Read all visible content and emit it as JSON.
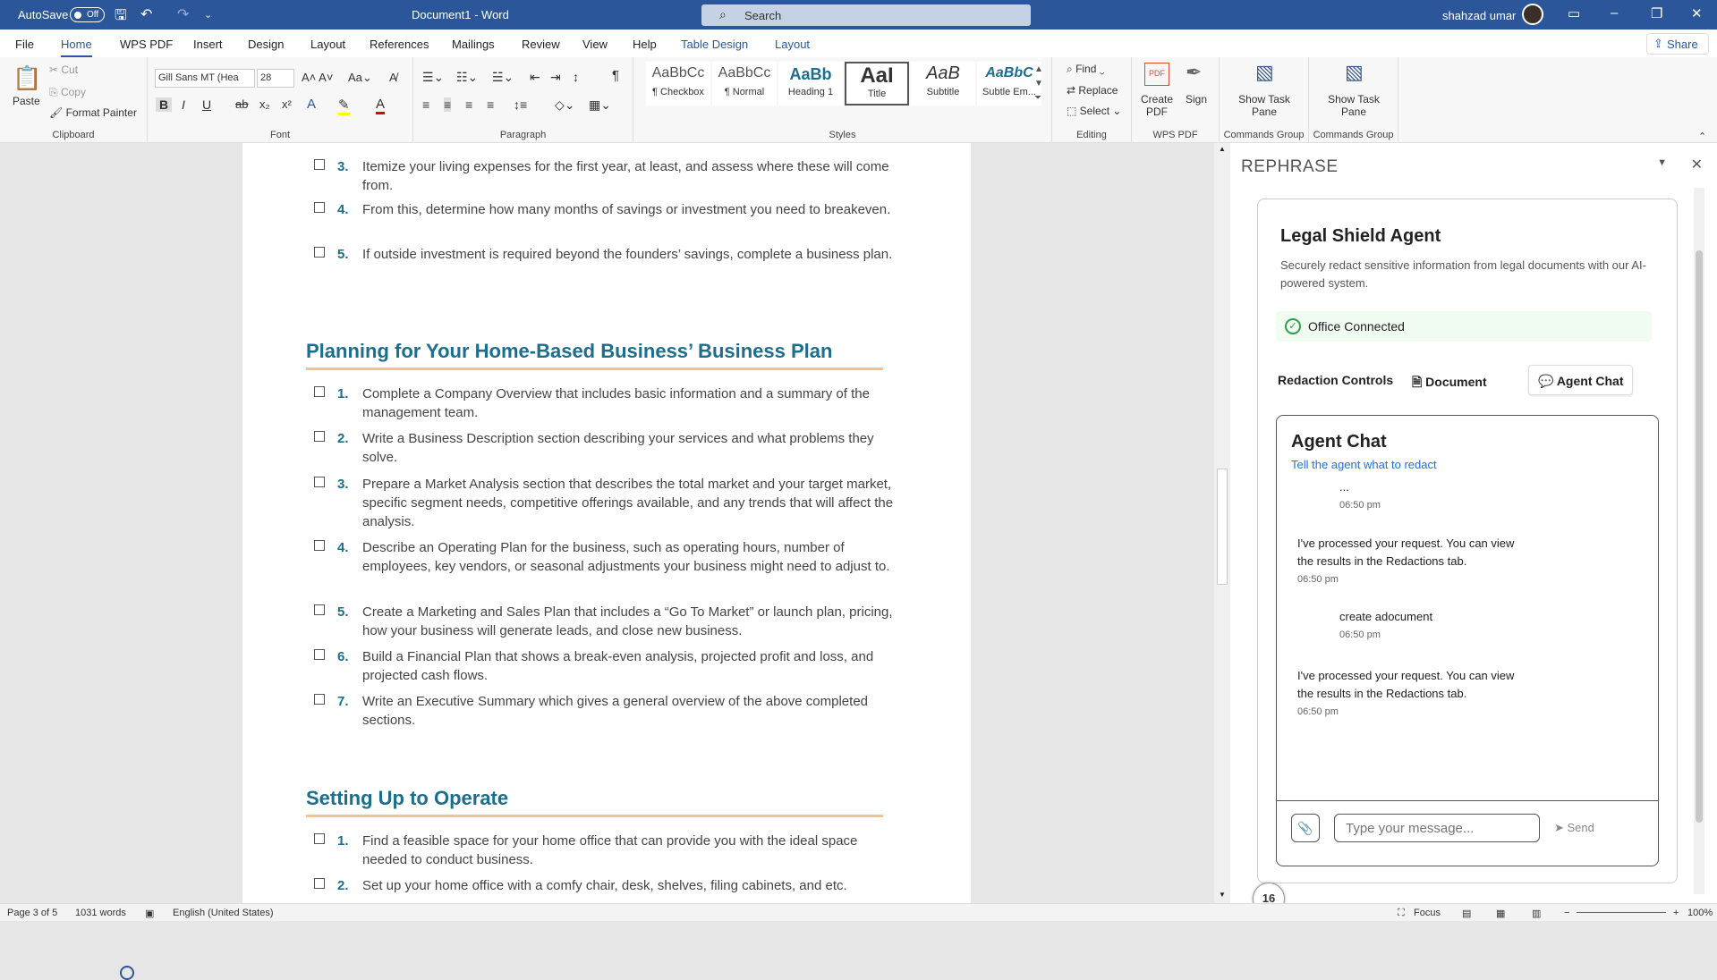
{
  "titlebar": {
    "autosave_label": "AutoSave",
    "autosave_state": "Off",
    "doc_title": "Document1 - Word",
    "search_placeholder": "Search",
    "user_name": "shahzad umar"
  },
  "menu": {
    "tabs": [
      "File",
      "Home",
      "WPS PDF",
      "Insert",
      "Design",
      "Layout",
      "References",
      "Mailings",
      "Review",
      "View",
      "Help",
      "Table Design",
      "Layout"
    ],
    "share": "Share"
  },
  "ribbon": {
    "clipboard": {
      "paste": "Paste",
      "cut": "Cut",
      "copy": "Copy",
      "format_painter": "Format Painter",
      "label": "Clipboard"
    },
    "font": {
      "family": "Gill Sans MT (Hea",
      "size": "28",
      "label": "Font"
    },
    "paragraph": {
      "label": "Paragraph"
    },
    "styles": {
      "label": "Styles",
      "items": [
        {
          "preview": "AaBbCc",
          "name": "¶ Checkbox"
        },
        {
          "preview": "AaBbCc",
          "name": "¶ Normal"
        },
        {
          "preview": "AaBb",
          "name": "Heading 1"
        },
        {
          "preview": "AaI",
          "name": "Title"
        },
        {
          "preview": "AaB",
          "name": "Subtitle"
        },
        {
          "preview": "AaBbC",
          "name": "Subtle Em..."
        }
      ]
    },
    "editing": {
      "find": "Find",
      "replace": "Replace",
      "select": "Select",
      "label": "Editing"
    },
    "wps": {
      "create_pdf": "Create PDF",
      "sign": "Sign",
      "label": "WPS PDF"
    },
    "commands": [
      {
        "label": "Show Task Pane",
        "group": "Commands Group"
      },
      {
        "label": "Show Task Pane",
        "group": "Commands Group"
      }
    ]
  },
  "document": {
    "list_top": [
      {
        "num": "3.",
        "text": "Itemize your living expenses for the first year, at least, and assess where these will come from."
      },
      {
        "num": "4.",
        "text": "From this, determine how many months of savings or investment you need to breakeven."
      },
      {
        "num": "5.",
        "text": "If outside investment is required beyond the founders’ savings, complete a business plan."
      }
    ],
    "heading1": "Planning for Your Home-Based Business’ Business Plan",
    "list_plan": [
      {
        "num": "1.",
        "text": "Complete a Company Overview that includes basic information and a summary of the management team."
      },
      {
        "num": "2.",
        "text": "Write a Business Description section describing your services and what problems they solve."
      },
      {
        "num": "3.",
        "text": "Prepare a Market Analysis section that describes the total market and your target market, specific segment needs, competitive offerings available, and any trends that will affect the analysis."
      },
      {
        "num": "4.",
        "text": "Describe an Operating Plan for the business, such as operating hours, number of employees, key vendors, or seasonal adjustments your business might need to adjust to."
      },
      {
        "num": "5.",
        "text": "Create a Marketing and Sales Plan that includes a “Go To Market” or launch plan, pricing, how your business will generate leads, and close new business."
      },
      {
        "num": "6.",
        "text": "Build a Financial Plan that shows a break-even analysis, projected profit and loss, and projected cash flows."
      },
      {
        "num": "7.",
        "text": "Write an Executive Summary which gives a general overview of the above completed sections."
      }
    ],
    "heading2": "Setting Up to Operate",
    "list_operate": [
      {
        "num": "1.",
        "text": "Find a feasible space for your home office that can provide you with the ideal space needed to conduct business."
      },
      {
        "num": "2.",
        "text": "Set up your home office with a comfy chair, desk, shelves, filing cabinets, and etc."
      }
    ]
  },
  "pane": {
    "title": "REPHRASE",
    "agent_title": "Legal Shield Agent",
    "agent_desc": "Securely redact sensitive information from legal documents with our AI-powered system.",
    "status": "Office Connected",
    "tabs": [
      "Redaction Controls",
      "Document",
      "Agent Chat"
    ],
    "chat_title": "Agent Chat",
    "chat_sub": "Tell the agent what to redact",
    "messages": [
      {
        "text": "...",
        "time": "06:50 pm",
        "from": "user"
      },
      {
        "text": "I've processed your request. You can view the results in the Redactions tab.",
        "time": "06:50 pm",
        "from": "agent"
      },
      {
        "text": "create adocument",
        "time": "06:50 pm",
        "from": "user"
      },
      {
        "text": "I've processed your request. You can view the results in the Redactions tab.",
        "time": "06:50 pm",
        "from": "agent"
      }
    ],
    "input_placeholder": "Type your message...",
    "send": "Send",
    "badge": "16"
  },
  "statusbar": {
    "page": "Page 3 of 5",
    "words": "1031 words",
    "language": "English (United States)",
    "focus": "Focus",
    "zoom": "100%"
  }
}
